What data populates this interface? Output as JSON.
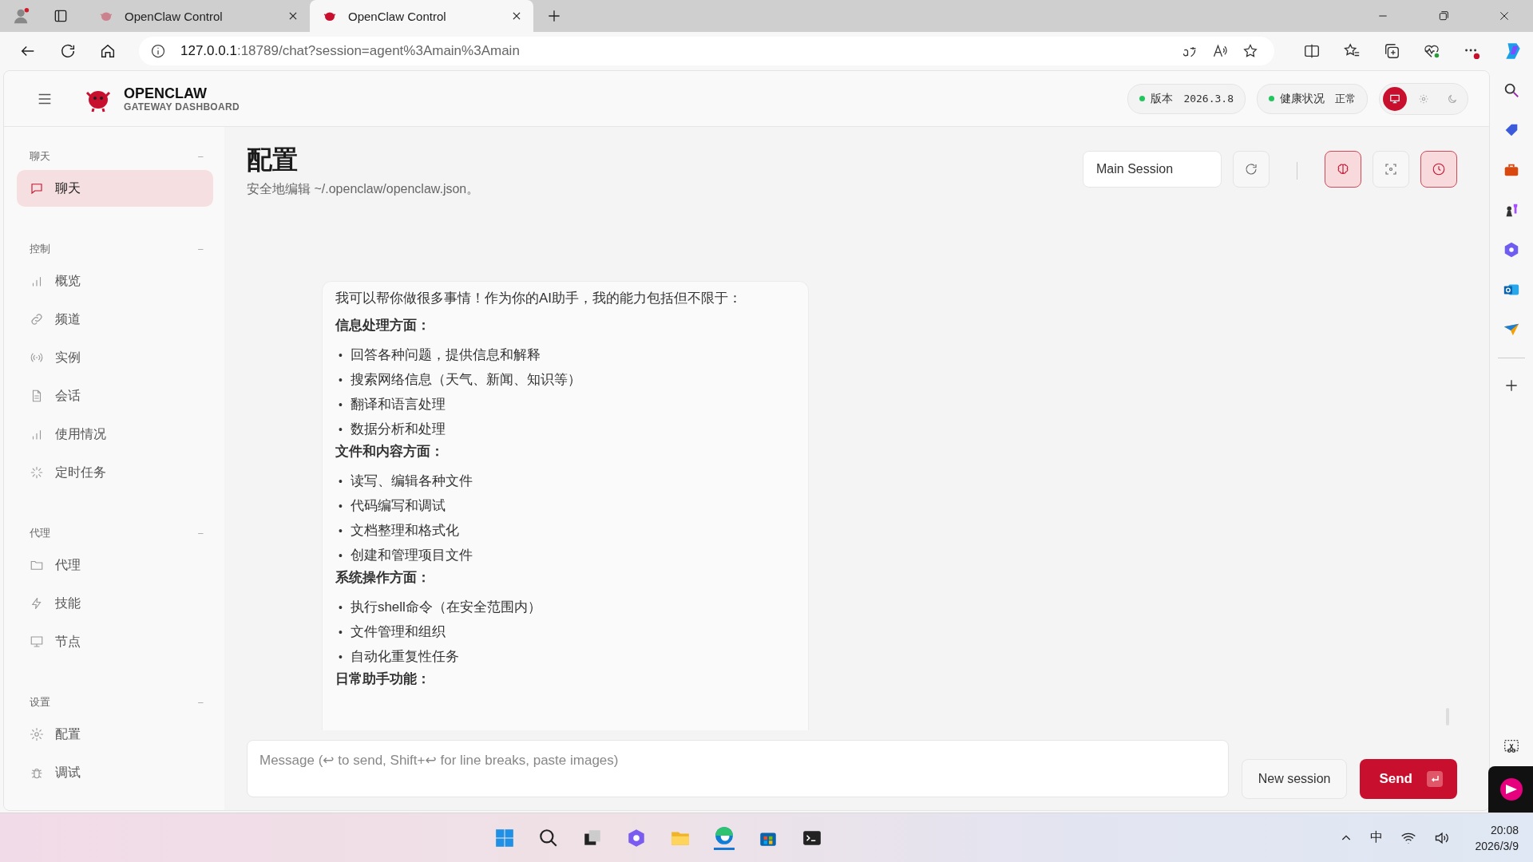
{
  "browser": {
    "tabs": [
      {
        "title": "OpenClaw Control",
        "selected": false
      },
      {
        "title": "OpenClaw Control",
        "selected": true
      }
    ],
    "address": {
      "host": "127.0.0.1",
      "path": ":18789/chat?session=agent%3Amain%3Amain"
    }
  },
  "header": {
    "brand": {
      "name": "OPENCLAW",
      "subtitle": "GATEWAY DASHBOARD"
    },
    "pills": [
      {
        "label": "版本",
        "value": "2026.3.8"
      },
      {
        "label": "健康状况",
        "value": "正常"
      }
    ],
    "theme_modes": [
      {
        "kind": "system",
        "selected": true
      },
      {
        "kind": "light",
        "selected": false
      },
      {
        "kind": "dark",
        "selected": false
      }
    ]
  },
  "sidebar": {
    "sections": [
      {
        "title": "聊天",
        "collapse": "−",
        "items": [
          {
            "label": "聊天",
            "kind": "chat",
            "selected": true
          }
        ]
      },
      {
        "title": "控制",
        "collapse": "−",
        "items": [
          {
            "label": "概览",
            "kind": "bars",
            "selected": false
          },
          {
            "label": "频道",
            "kind": "link",
            "selected": false
          },
          {
            "label": "实例",
            "kind": "radio",
            "selected": false
          },
          {
            "label": "会话",
            "kind": "doc",
            "selected": false
          },
          {
            "label": "使用情况",
            "kind": "bars",
            "selected": false
          },
          {
            "label": "定时任务",
            "kind": "spinner",
            "selected": false
          }
        ]
      },
      {
        "title": "代理",
        "collapse": "−",
        "items": [
          {
            "label": "代理",
            "kind": "folder",
            "selected": false
          },
          {
            "label": "技能",
            "kind": "bolt",
            "selected": false
          },
          {
            "label": "节点",
            "kind": "monitor",
            "selected": false
          }
        ]
      },
      {
        "title": "设置",
        "collapse": "−",
        "items": [
          {
            "label": "配置",
            "kind": "gear",
            "selected": false
          },
          {
            "label": "调试",
            "kind": "bug",
            "selected": false
          }
        ]
      }
    ]
  },
  "page": {
    "title": "配置",
    "subtitle": "安全地编辑 ~/.openclaw/openclaw.json。",
    "session": "Main Session",
    "tools": [
      {
        "kind": "refresh",
        "selected": false
      },
      {
        "kind": "brain",
        "selected": true
      },
      {
        "kind": "focus",
        "selected": false
      },
      {
        "kind": "clock",
        "selected": true
      }
    ]
  },
  "message": {
    "marker": "•",
    "intro": "我可以帮你做很多事情！作为你的AI助手，我的能力包括但不限于：",
    "sections": [
      {
        "heading": "信息处理方面：",
        "bullets": [
          "回答各种问题，提供信息和解释",
          "搜索网络信息（天气、新闻、知识等）",
          "翻译和语言处理",
          "数据分析和处理"
        ]
      },
      {
        "heading": "文件和内容方面：",
        "bullets": [
          "读写、编辑各种文件",
          "代码编写和调试",
          "文档整理和格式化",
          "创建和管理项目文件"
        ]
      },
      {
        "heading": "系统操作方面：",
        "bullets": [
          "执行shell命令（在安全范围内）",
          "文件管理和组织",
          "自动化重复性任务"
        ]
      },
      {
        "heading": "日常助手功能："
      }
    ]
  },
  "composer": {
    "placeholder": "Message (↩ to send, Shift+↩ for line breaks, paste images)",
    "new_session": "New session",
    "send": "Send"
  },
  "taskbar": {
    "ime": "中",
    "time": "20:08",
    "date": "2026/3/9"
  }
}
